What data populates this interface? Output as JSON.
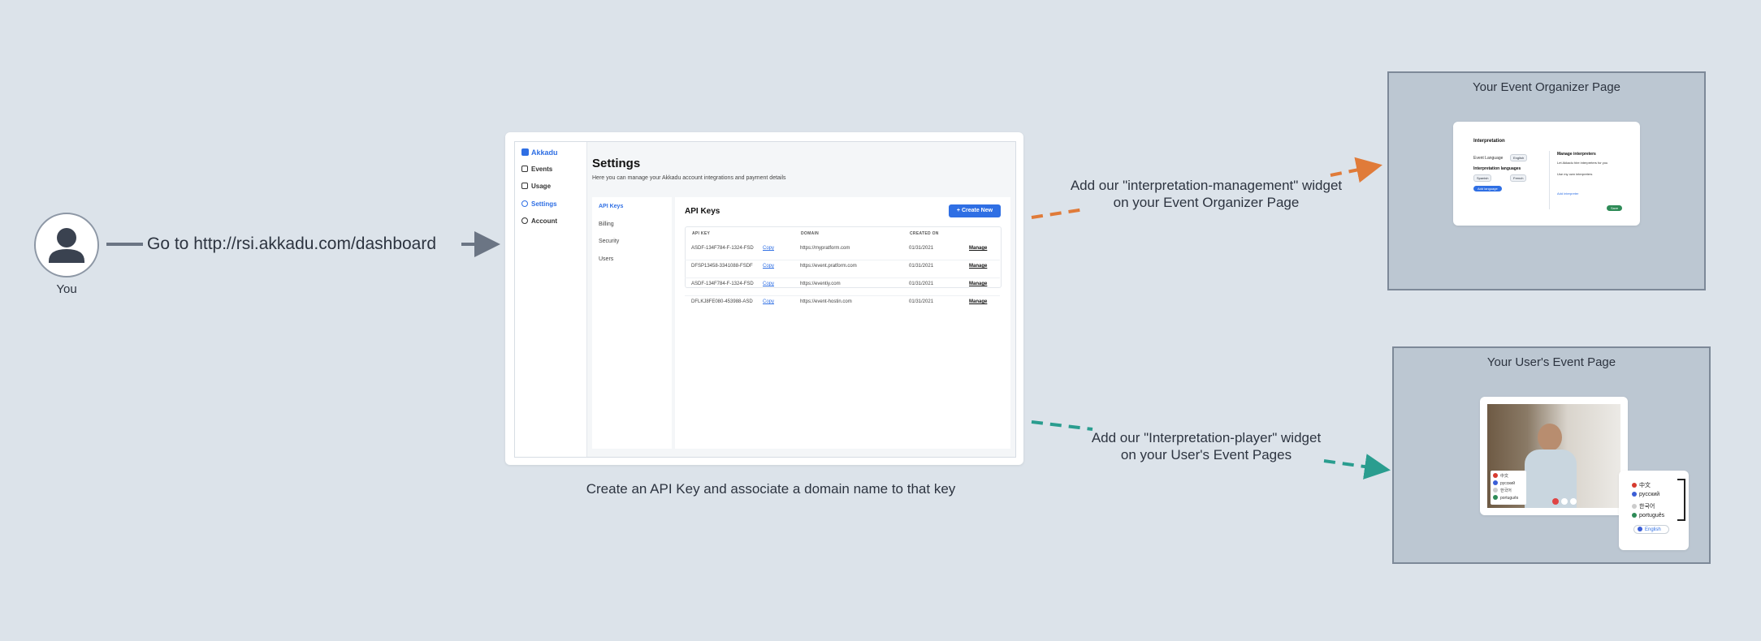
{
  "user": {
    "label": "You",
    "icon": "user-icon"
  },
  "step1": {
    "text": "Go to http://rsi.akkadu.com/dashboard"
  },
  "step2": {
    "caption": "Create an API Key and associate a domain name to that key"
  },
  "dashboard": {
    "brand": "Akkadu",
    "nav": [
      {
        "label": "Events",
        "icon": "calendar-icon"
      },
      {
        "label": "Usage",
        "icon": "chart-icon"
      },
      {
        "label": "Settings",
        "icon": "gear-icon",
        "active": true
      },
      {
        "label": "Account",
        "icon": "person-icon"
      }
    ],
    "title": "Settings",
    "subtitle": "Here you can manage your Akkadu account integrations and payment details",
    "subnav": [
      "API Keys",
      "Billing",
      "Security",
      "Users"
    ],
    "panel_title": "API Keys",
    "create_button": "+ Create New",
    "columns": [
      "API KEY",
      "DOMAIN",
      "CREATED ON"
    ],
    "rows": [
      {
        "key": "ASDF-134F784-F-1324-FSD",
        "copy": "Copy",
        "domain": "https://mypratform.com",
        "created": "01/31/2021",
        "action": "Manage"
      },
      {
        "key": "DFSP13458-3341088-FSDF",
        "copy": "Copy",
        "domain": "https://event.pratform.com",
        "created": "01/31/2021",
        "action": "Manage"
      },
      {
        "key": "ASDF-134F784-F-1324-FSD",
        "copy": "Copy",
        "domain": "https://eventiy.com",
        "created": "01/31/2021",
        "action": "Manage"
      },
      {
        "key": "DFLKJ8FE080-453988-ASD",
        "copy": "Copy",
        "domain": "https://event-hostin.com",
        "created": "01/31/2021",
        "action": "Manage"
      }
    ]
  },
  "organizer": {
    "caption_line1": "Add our \"interpretation-management\" widget",
    "caption_line2": "on your Event Organizer Page",
    "box_title": "Your Event Organizer Page",
    "widget": {
      "title": "Interpretation",
      "event_language_label": "Event Language",
      "event_language_value": "English",
      "languages_label": "Interpretation languages",
      "lang_a": "Spanish",
      "lang_b": "French",
      "add_button": "Add language",
      "manage_title": "Manage interpreters",
      "option_a": "Let Akkadu hire interpreters for you",
      "option_b": "Use my own interpreters",
      "link": "Add interpreter",
      "save_button": "Save"
    }
  },
  "player": {
    "caption_line1": "Add our \"Interpretation-player\" widget",
    "caption_line2": "on your User's Event Pages",
    "box_title": "Your User's Event Page",
    "video_langs": [
      "中文",
      "pусский",
      "한국어",
      "português"
    ],
    "popup_langs": [
      "中文",
      "pусский",
      "한국어",
      "português"
    ],
    "selected_lang": "English"
  },
  "colors": {
    "background": "#dce3ea",
    "accent_blue": "#2f6fe4",
    "orange_arrow": "#e07b39",
    "teal_arrow": "#2a9d8f",
    "gray_arrow": "#6b7584"
  }
}
